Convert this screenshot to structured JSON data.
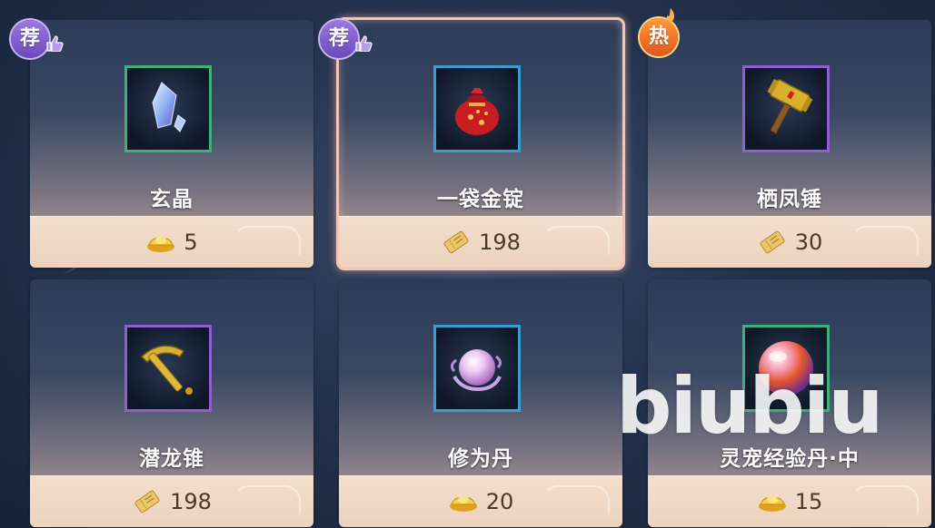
{
  "items": [
    {
      "name": "玄晶",
      "price": "5",
      "currency_icon": "gold-ingot-icon",
      "badge": "荐",
      "item_icon": "crystal-icon",
      "rarity_color": "#3fb07c"
    },
    {
      "name": "一袋金锭",
      "price": "198",
      "currency_icon": "ticket-icon",
      "badge": "荐",
      "item_icon": "money-bag-icon",
      "rarity_color": "#3a9cd0",
      "selected": true
    },
    {
      "name": "栖凤锤",
      "price": "30",
      "currency_icon": "ticket-icon",
      "badge": "热",
      "item_icon": "hammer-icon",
      "rarity_color": "#8e5fd2"
    },
    {
      "name": "潜龙锥",
      "price": "198",
      "currency_icon": "ticket-icon",
      "badge": "",
      "item_icon": "pickaxe-icon",
      "rarity_color": "#8e5fd2"
    },
    {
      "name": "修为丹",
      "price": "20",
      "currency_icon": "gold-ingot-icon",
      "badge": "",
      "item_icon": "pearl-icon",
      "rarity_color": "#3a9cd0"
    },
    {
      "name": "灵宠经验丹·中",
      "price": "15",
      "currency_icon": "gold-ingot-icon",
      "badge": "",
      "item_icon": "gem-orb-icon",
      "rarity_color": "#3fb07c"
    }
  ],
  "watermark": "biubiu"
}
